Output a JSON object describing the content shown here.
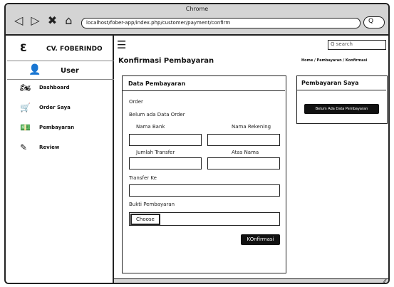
{
  "browser": {
    "title": "Chrome",
    "url": "localhost/fober-app/index.php/customer/payment/confirm",
    "nav_icons": "◁ ▷ ✖ ⌂",
    "search_pill_icon": "Q"
  },
  "sidebar": {
    "brand_logo": "Ɛ",
    "brand_name": "CV. FOBERINDO",
    "user_icon": "👤",
    "user_name": "User",
    "items": [
      {
        "icon": "🏍",
        "label": "Dashboard"
      },
      {
        "icon": "🛒",
        "label": "Order Saya"
      },
      {
        "icon": "💵",
        "label": "Pembayaran"
      },
      {
        "icon": "✎",
        "label": "Review"
      }
    ]
  },
  "header": {
    "menu_icon": "☰",
    "search_placeholder": "Q search"
  },
  "page": {
    "title": "Konfirmasi Pembayaran",
    "breadcrumb": "Home / Pembayaran / Konfirmasi"
  },
  "form": {
    "title": "Data Pembayaran",
    "order_label": "Order",
    "order_value": "Belum ada Data Order",
    "nama_bank_label": "Nama Bank",
    "nama_rekening_label": "Nama Rekening",
    "jumlah_transfer_label": "Jumlah Transfer",
    "atas_nama_label": "Atas Nama",
    "transfer_ke_label": "Transfer Ke",
    "bukti_label": "Bukti Pembayaran",
    "choose_label": "Choose",
    "submit_label": "KOnfirmasi"
  },
  "right_card": {
    "title": "Pembayaran Saya",
    "button_label": "Belum Ada Data Pembayaran"
  }
}
